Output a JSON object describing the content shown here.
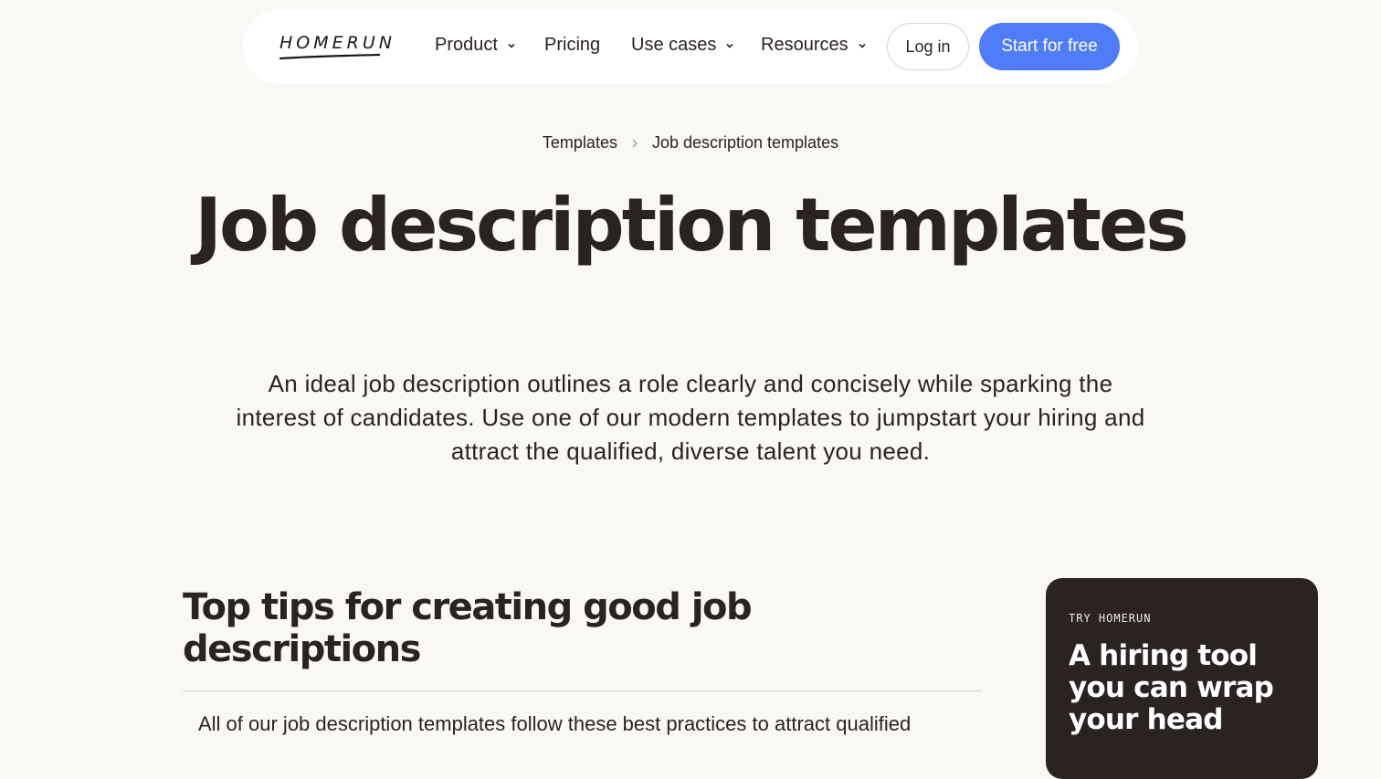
{
  "nav": {
    "logo": "HOMERUN",
    "items": [
      {
        "label": "Product",
        "dropdown": true
      },
      {
        "label": "Pricing",
        "dropdown": false
      },
      {
        "label": "Use cases",
        "dropdown": true
      },
      {
        "label": "Resources",
        "dropdown": true
      }
    ],
    "login_label": "Log in",
    "start_label": "Start for free"
  },
  "breadcrumb": {
    "items": [
      "Templates",
      "Job description templates"
    ]
  },
  "hero": {
    "title": "Job description templates",
    "description": "An ideal job description outlines a role clearly and concisely while sparking the interest of candidates. Use one of our modern templates to jumpstart your hiring and attract the qualified, diverse talent you need."
  },
  "tips": {
    "title": "Top tips for creating good job descriptions",
    "intro": "All of our job description templates follow these best practices to attract qualified"
  },
  "promo": {
    "kicker": "TRY HOMERUN",
    "title": "A hiring tool you can wrap your head"
  },
  "colors": {
    "background": "#f9f8f4",
    "accent": "#4f7cf7",
    "text": "#2a2321",
    "promo_bg": "#2a2321"
  },
  "icons": [
    "chevron-down-icon",
    "chevron-right-icon"
  ]
}
